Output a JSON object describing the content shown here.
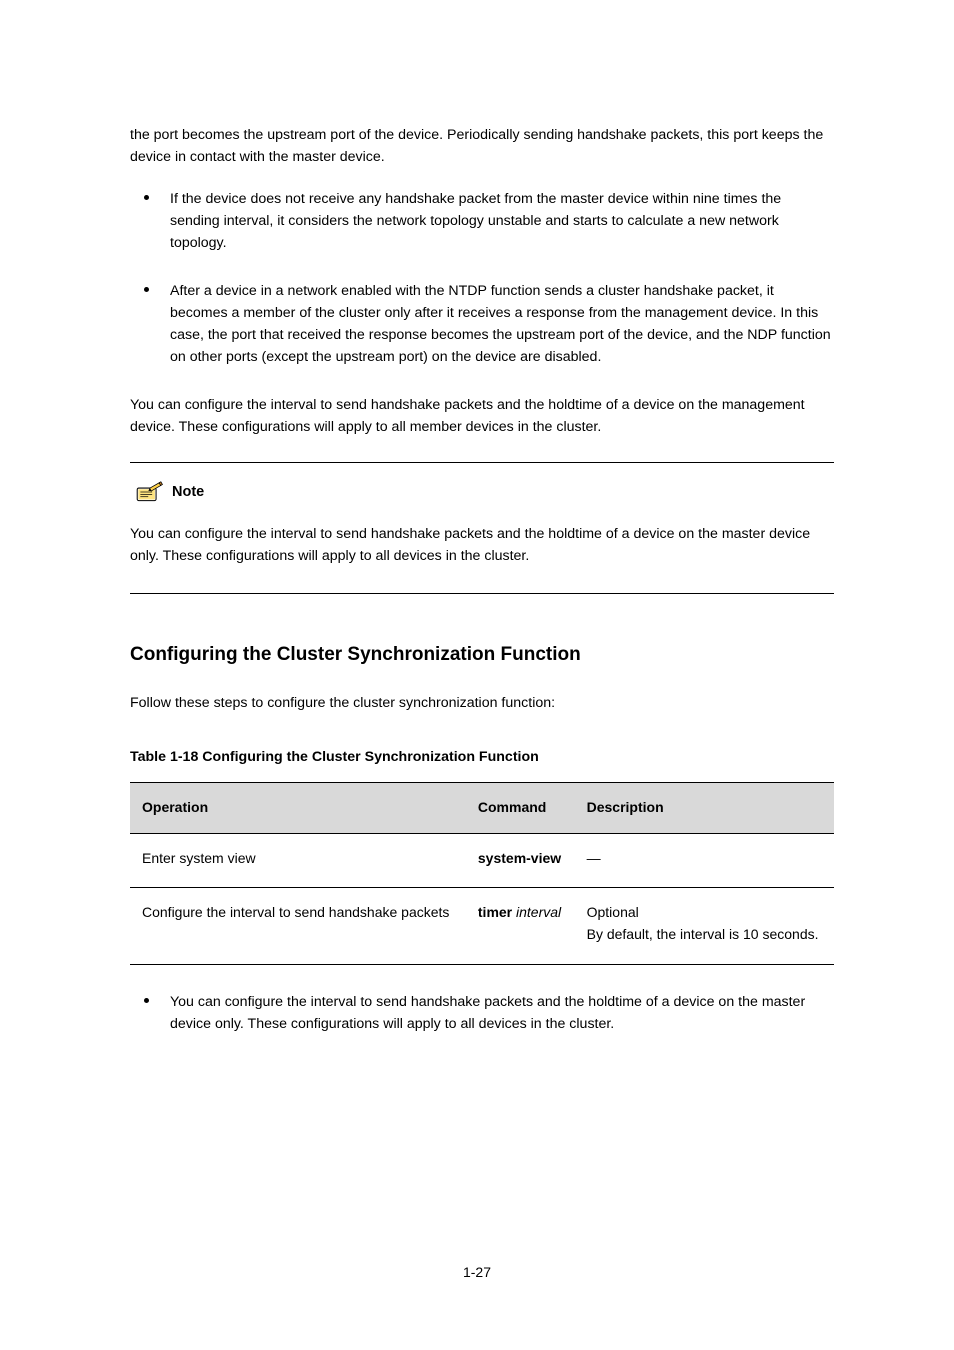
{
  "intro_para": "the port becomes the upstream port of the device. Periodically sending handshake packets, this port keeps the device in contact with the master device.",
  "bullets": [
    "If the device does not receive any handshake packet from the master device within nine times the sending interval, it considers the network topology unstable and starts to calculate a new network topology.",
    "After a device in a network enabled with the NTDP function sends a cluster handshake packet, it becomes a member of the cluster only after it receives a response from the management device. In this case, the port that received the response becomes the upstream port of the device, and the NDP function on other ports (except the upstream port) on the device are disabled."
  ],
  "closing_para": "You can configure the interval to send handshake packets and the holdtime of a device on the management device. These configurations will apply to all member devices in the cluster.",
  "note": {
    "label": "Note",
    "body": "You can configure the interval to send handshake packets and the holdtime of a device on the master device only. These configurations will apply to all devices in the cluster."
  },
  "section": {
    "title": "Configuring the Cluster Synchronization Function",
    "lead": "Follow these steps to configure the cluster synchronization function:",
    "table_caption": "Table 1-18 Configuring the Cluster Synchronization Function"
  },
  "table": {
    "headers": [
      "Operation",
      "Command",
      "Description"
    ],
    "rows": [
      {
        "operation": "Enter system view",
        "command_bold": "system-view",
        "command_italic": "",
        "description": "—"
      },
      {
        "operation": "Configure the interval to send handshake packets",
        "command_bold": "timer",
        "command_italic": " interval",
        "description": "Optional\nBy default, the interval is 10 seconds."
      }
    ]
  },
  "notes_after": [
    "You can configure the interval to send handshake packets and the holdtime of a device on the master device only. These configurations will apply to all devices in the cluster."
  ],
  "page_number": "1-27"
}
